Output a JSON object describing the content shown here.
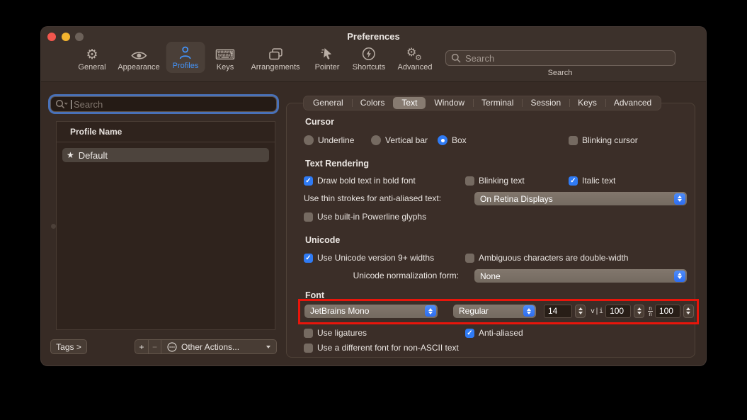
{
  "window": {
    "title": "Preferences"
  },
  "toolbar": {
    "items": [
      {
        "label": "General"
      },
      {
        "label": "Appearance"
      },
      {
        "label": "Profiles"
      },
      {
        "label": "Keys"
      },
      {
        "label": "Arrangements"
      },
      {
        "label": "Pointer"
      },
      {
        "label": "Shortcuts"
      },
      {
        "label": "Advanced"
      }
    ],
    "selected": "Profiles",
    "search": {
      "placeholder": "Search",
      "caption": "Search"
    }
  },
  "sidebar": {
    "search": {
      "placeholder": "Search"
    },
    "list": {
      "header": "Profile Name",
      "rows": [
        {
          "star": "★",
          "name": "Default",
          "selected": true
        }
      ]
    },
    "buttons": {
      "tags": "Tags >",
      "add": "+",
      "remove": "−",
      "other_actions": "Other Actions..."
    }
  },
  "tabs": {
    "selected": "Text",
    "items": [
      {
        "label": "General"
      },
      {
        "label": "Colors"
      },
      {
        "label": "Text"
      },
      {
        "label": "Window"
      },
      {
        "label": "Terminal"
      },
      {
        "label": "Session"
      },
      {
        "label": "Keys"
      },
      {
        "label": "Advanced"
      }
    ]
  },
  "panel": {
    "cursor": {
      "heading": "Cursor",
      "underline": "Underline",
      "vertical_bar": "Vertical bar",
      "box": "Box",
      "selected": "Box",
      "blinking": "Blinking cursor",
      "blinking_checked": false
    },
    "text_rendering": {
      "heading": "Text Rendering",
      "draw_bold": "Draw bold text in bold font",
      "draw_bold_checked": true,
      "blinking_text": "Blinking text",
      "blinking_text_checked": false,
      "italic_text": "Italic text",
      "italic_text_checked": true,
      "thin_strokes_label": "Use thin strokes for anti-aliased text:",
      "thin_strokes_value": "On Retina Displays",
      "powerline": "Use built-in Powerline glyphs",
      "powerline_checked": false
    },
    "unicode": {
      "heading": "Unicode",
      "v9": "Use Unicode version 9+ widths",
      "v9_checked": true,
      "ambiguous": "Ambiguous characters are double-width",
      "ambiguous_checked": false,
      "normalization_label": "Unicode normalization form:",
      "normalization_value": "None"
    },
    "font": {
      "heading": "Font",
      "family": "JetBrains Mono",
      "style": "Regular",
      "size": "14",
      "h_spacing": "100",
      "v_spacing": "100",
      "h_spacing_icon": "v|i",
      "v_spacing_icon_top": "n",
      "v_spacing_icon_bottom": "n",
      "ligatures": "Use ligatures",
      "ligatures_checked": false,
      "antialiased": "Anti-aliased",
      "antialiased_checked": true,
      "non_ascii": "Use a different font for non-ASCII text",
      "non_ascii_checked": false
    }
  },
  "icons": {
    "gear": "⚙",
    "keyboard": "⌨",
    "star": "★"
  },
  "colors": {
    "accent_blue": "#3478f6",
    "annotation_red": "#e8150b",
    "selected_toolbar_text": "#4493f8",
    "traffic_red": "#f2564d",
    "traffic_yellow": "#f3b42f",
    "traffic_gray": "#6c6159"
  }
}
